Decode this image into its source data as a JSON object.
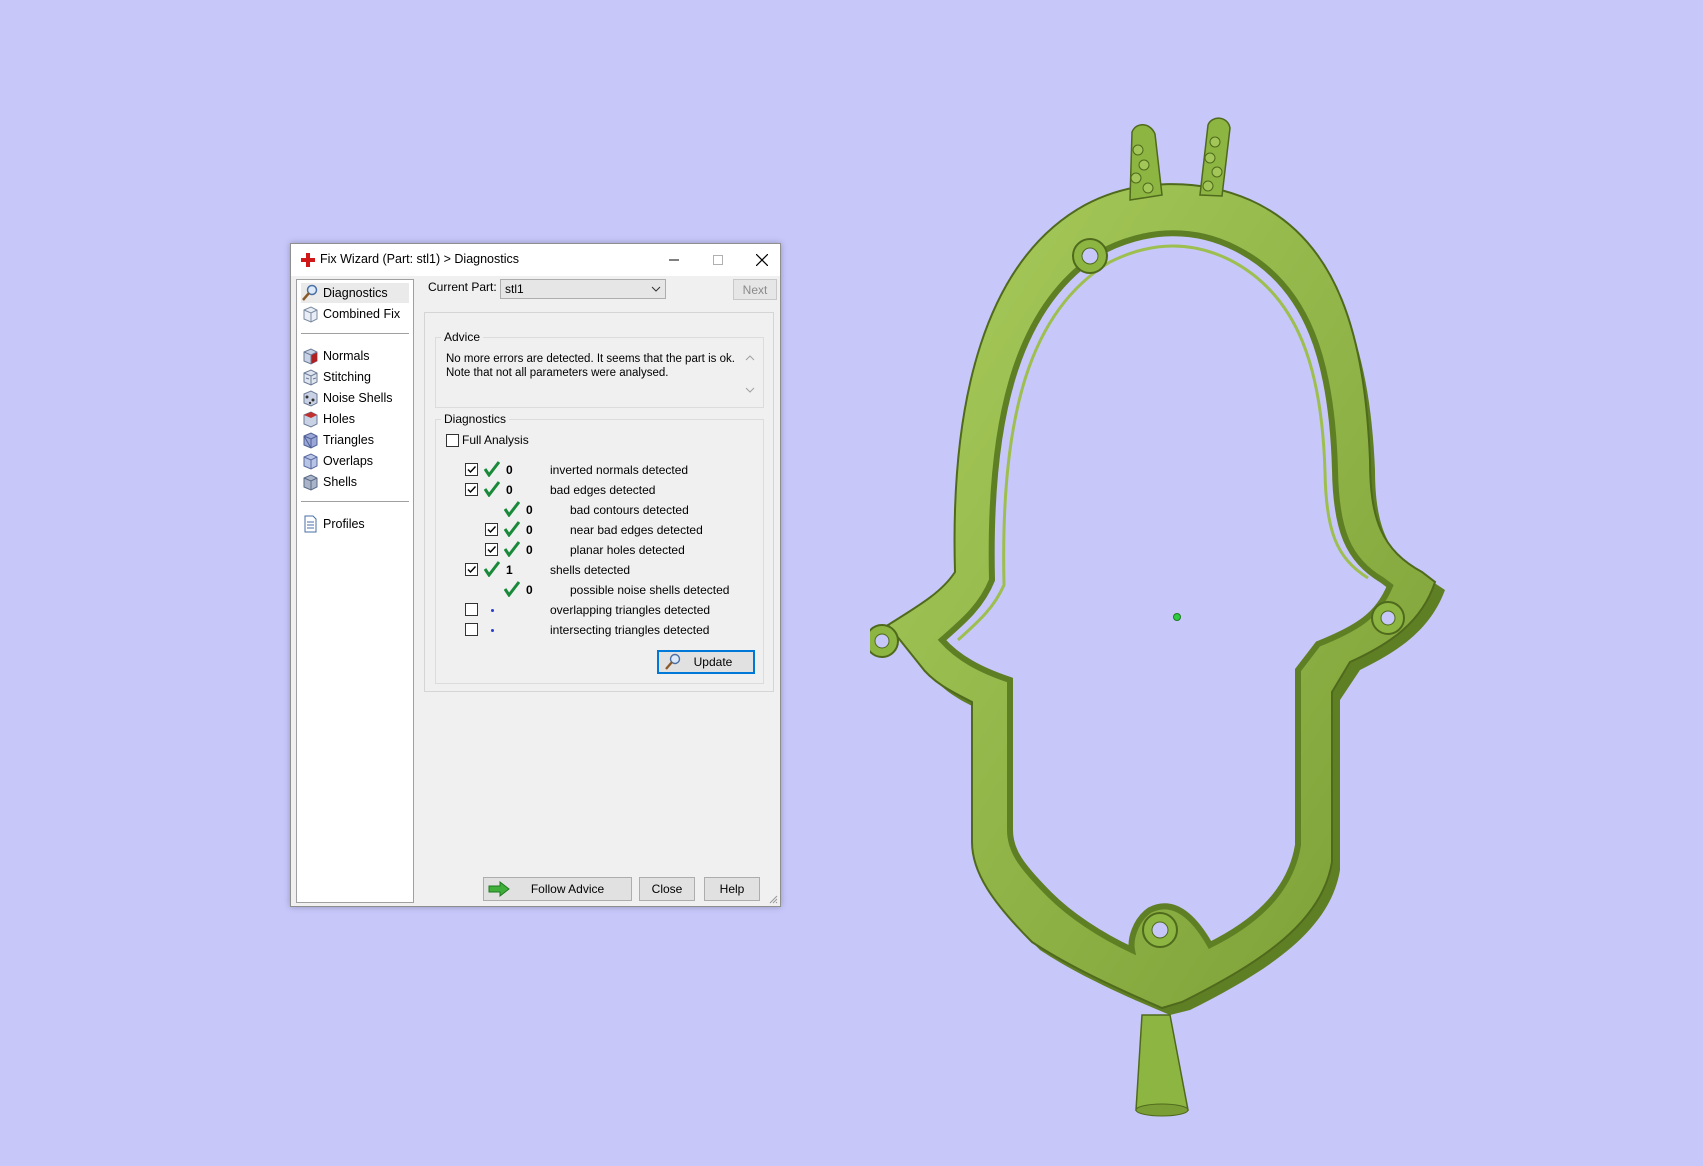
{
  "window": {
    "title": "Fix Wizard (Part: stl1) > Diagnostics",
    "controls": [
      "minimize",
      "maximize",
      "close"
    ]
  },
  "sidebar": {
    "items_top": [
      {
        "label": "Diagnostics",
        "icon": "magnifier-icon",
        "selected": true
      },
      {
        "label": "Combined Fix",
        "icon": "cube-icon"
      }
    ],
    "items_mid": [
      {
        "label": "Normals",
        "icon": "normals-cube-icon"
      },
      {
        "label": "Stitching",
        "icon": "stitching-cube-icon"
      },
      {
        "label": "Noise Shells",
        "icon": "noise-shells-icon"
      },
      {
        "label": "Holes",
        "icon": "holes-cube-icon"
      },
      {
        "label": "Triangles",
        "icon": "triangles-cube-icon"
      },
      {
        "label": "Overlaps",
        "icon": "overlaps-cube-icon"
      },
      {
        "label": "Shells",
        "icon": "shells-cube-icon"
      }
    ],
    "items_bottom": [
      {
        "label": "Profiles",
        "icon": "document-icon"
      }
    ]
  },
  "current_part": {
    "label": "Current Part:",
    "value": "stl1",
    "next_label": "Next"
  },
  "advice": {
    "title": "Advice",
    "text": "No more errors are detected. It seems that the part is ok. Note that not all parameters were analysed."
  },
  "diagnostics": {
    "title": "Diagnostics",
    "full_analysis_label": "Full Analysis",
    "full_analysis_checked": false,
    "rows": [
      {
        "checked": true,
        "status": "ok",
        "count": "0",
        "text": "inverted normals detected",
        "indent": 0
      },
      {
        "checked": true,
        "status": "ok",
        "count": "0",
        "text": "bad edges detected",
        "indent": 0
      },
      {
        "checked": null,
        "status": "ok",
        "count": "0",
        "text": "bad contours detected",
        "indent": 1
      },
      {
        "checked": true,
        "status": "ok",
        "count": "0",
        "text": "near bad edges detected",
        "indent": 1
      },
      {
        "checked": true,
        "status": "ok",
        "count": "0",
        "text": "planar holes detected",
        "indent": 1
      },
      {
        "checked": true,
        "status": "ok",
        "count": "1",
        "text": "shells detected",
        "indent": 0
      },
      {
        "checked": null,
        "status": "ok",
        "count": "0",
        "text": "possible noise shells detected",
        "indent": 1
      },
      {
        "checked": false,
        "status": "not-run",
        "count": "",
        "text": "overlapping triangles detected",
        "indent": 0
      },
      {
        "checked": false,
        "status": "not-run",
        "count": "",
        "text": "intersecting triangles detected",
        "indent": 0
      }
    ],
    "update_label": "Update"
  },
  "footer": {
    "follow_advice_label": "Follow Advice",
    "close_label": "Close",
    "help_label": "Help"
  },
  "colors": {
    "background": "#c7c7fa",
    "model_green": "#8db542",
    "check_green": "#1a8a3a",
    "accent_blue": "#0078d7"
  },
  "viewport": {
    "model": "green pendant frame with loop and sprue"
  }
}
